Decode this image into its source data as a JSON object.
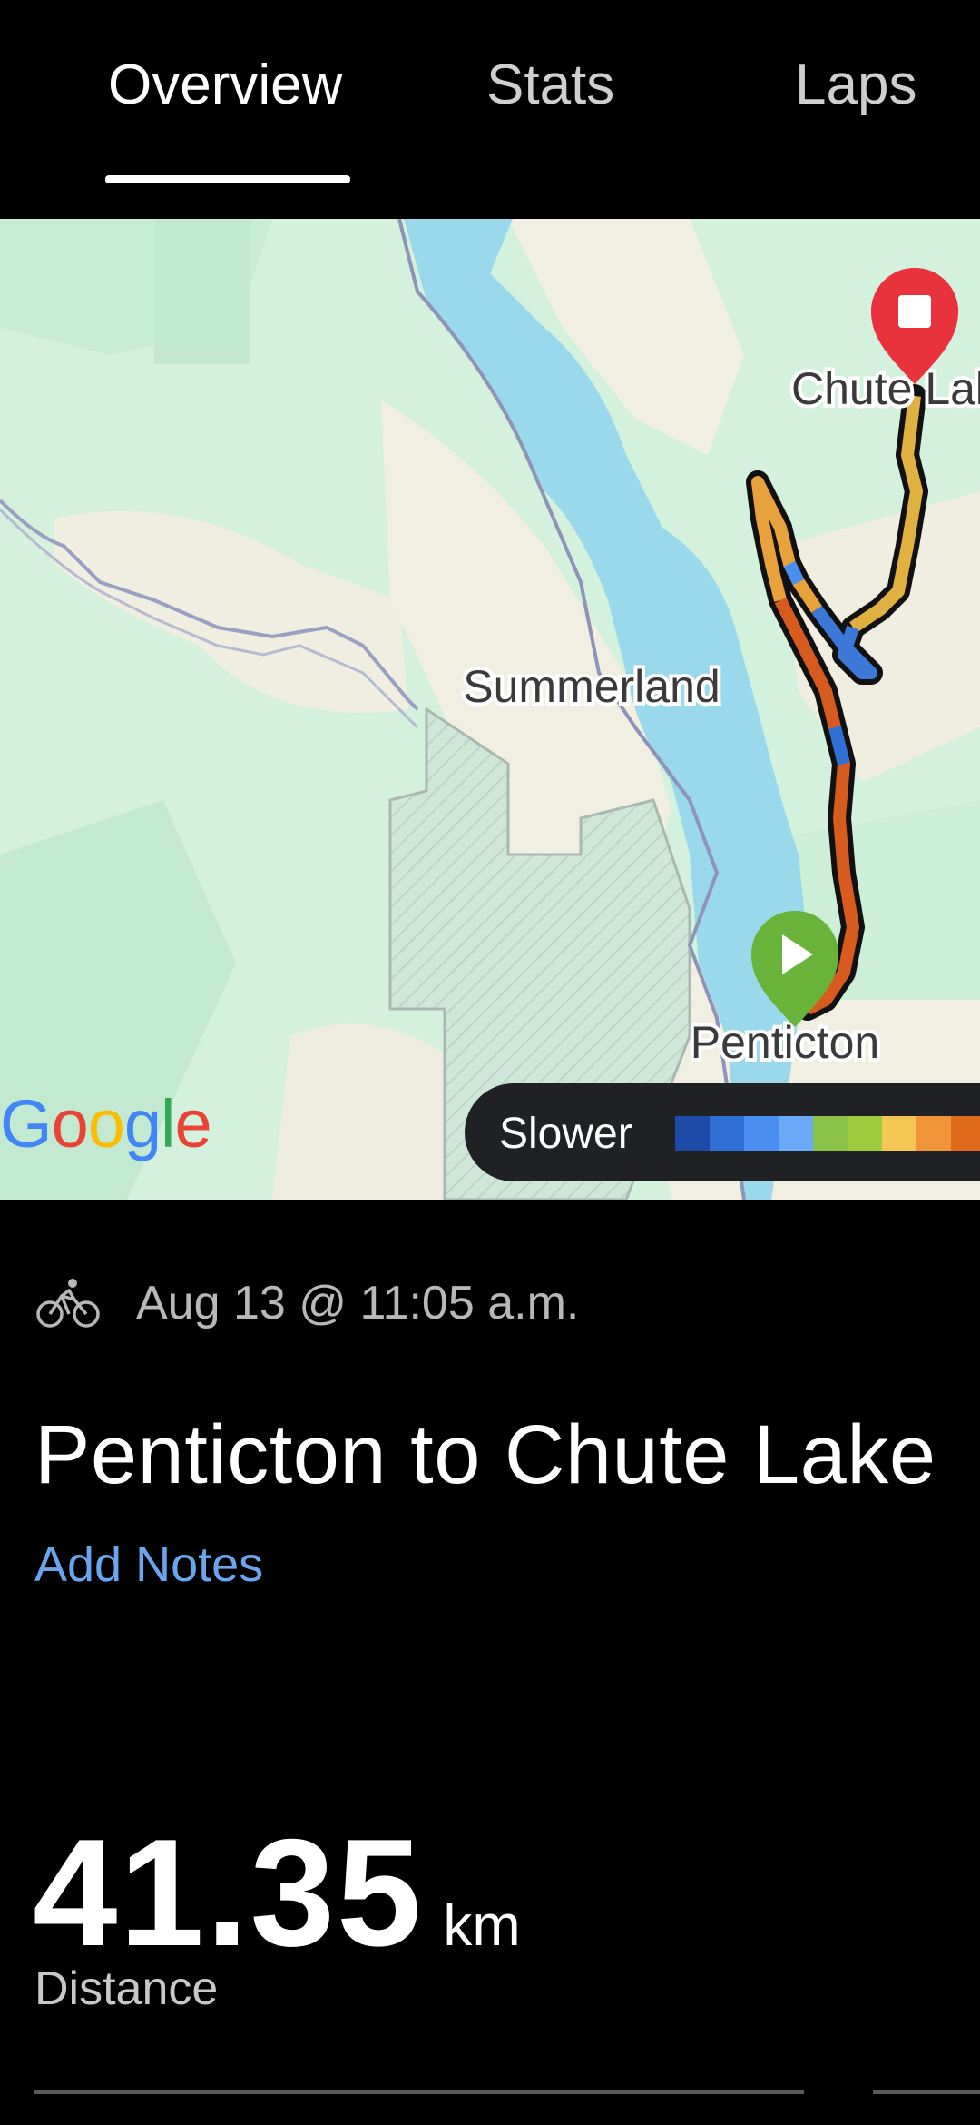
{
  "tabs": [
    {
      "label": "Overview",
      "active": true
    },
    {
      "label": "Stats",
      "active": false
    },
    {
      "label": "Laps",
      "active": false
    }
  ],
  "map": {
    "labels": {
      "summerland": "Summerland",
      "penticton": "Penticton",
      "chute_lake": "Chute Lake"
    },
    "google_logo": "Google",
    "legend": {
      "label": "Slower",
      "colors": [
        "#1e4aa8",
        "#2f6fd6",
        "#4a8ef0",
        "#6aa9f6",
        "#8bc34a",
        "#9ccc3d",
        "#f4c653",
        "#f0943a",
        "#e06a1c"
      ]
    },
    "start_marker": "play-icon",
    "end_marker": "stop-icon"
  },
  "activity": {
    "type_icon": "bicycle-icon",
    "date": "Aug 13 @ 11:05 a.m.",
    "title": "Penticton to Chute Lake",
    "add_notes": "Add Notes"
  },
  "stats": {
    "distance_value": "41.35",
    "distance_unit": "km",
    "distance_label": "Distance"
  },
  "colors": {
    "background": "#000000",
    "accent_link": "#6aa6ee",
    "water": "#9ad8ec",
    "terrain": "#d8f3e1"
  }
}
